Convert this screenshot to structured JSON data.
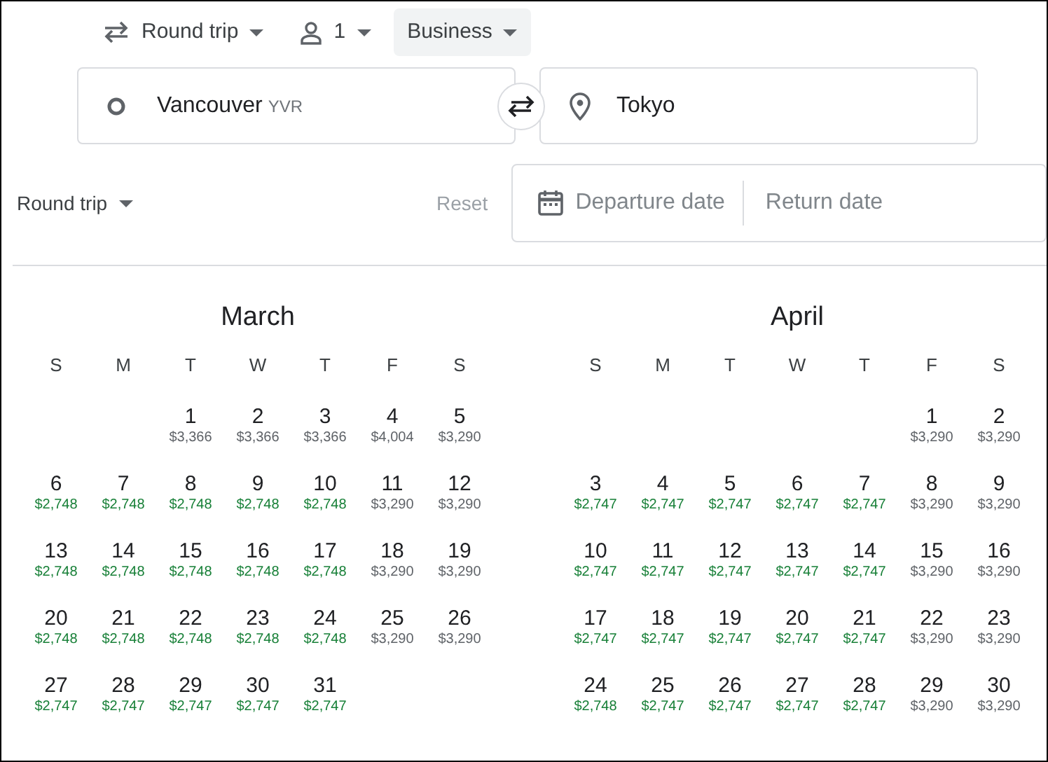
{
  "top_bar": {
    "trip_type": "Round trip",
    "passengers": "1",
    "cabin_class": "Business"
  },
  "route": {
    "origin": {
      "city": "Vancouver",
      "code": "YVR"
    },
    "destination": {
      "city": "Tokyo"
    }
  },
  "date_bar": {
    "trip_type": "Round trip",
    "reset": {
      "label": "Reset",
      "disabled": true
    },
    "departure_placeholder": "Departure date",
    "return_placeholder": "Return date"
  },
  "months": [
    {
      "name": "March",
      "weekdays": [
        "S",
        "M",
        "T",
        "W",
        "T",
        "F",
        "S"
      ],
      "weeks": [
        [
          {
            "day": "1",
            "price": "$3,366",
            "low": false
          },
          {
            "day": "2",
            "price": "$3,366",
            "low": false
          },
          {
            "day": "3",
            "price": "$3,366",
            "low": false
          },
          {
            "day": "4",
            "price": "$4,004",
            "low": false
          },
          {
            "day": "5",
            "price": "$3,290",
            "low": false
          }
        ],
        [
          {
            "day": "6",
            "price": "$2,748",
            "low": true
          },
          {
            "day": "7",
            "price": "$2,748",
            "low": true
          },
          {
            "day": "8",
            "price": "$2,748",
            "low": true
          },
          {
            "day": "9",
            "price": "$2,748",
            "low": true
          },
          {
            "day": "10",
            "price": "$2,748",
            "low": true
          },
          {
            "day": "11",
            "price": "$3,290",
            "low": false
          },
          {
            "day": "12",
            "price": "$3,290",
            "low": false
          }
        ],
        [
          {
            "day": "13",
            "price": "$2,748",
            "low": true
          },
          {
            "day": "14",
            "price": "$2,748",
            "low": true
          },
          {
            "day": "15",
            "price": "$2,748",
            "low": true
          },
          {
            "day": "16",
            "price": "$2,748",
            "low": true
          },
          {
            "day": "17",
            "price": "$2,748",
            "low": true
          },
          {
            "day": "18",
            "price": "$3,290",
            "low": false
          },
          {
            "day": "19",
            "price": "$3,290",
            "low": false
          }
        ],
        [
          {
            "day": "20",
            "price": "$2,748",
            "low": true
          },
          {
            "day": "21",
            "price": "$2,748",
            "low": true
          },
          {
            "day": "22",
            "price": "$2,748",
            "low": true
          },
          {
            "day": "23",
            "price": "$2,748",
            "low": true
          },
          {
            "day": "24",
            "price": "$2,748",
            "low": true
          },
          {
            "day": "25",
            "price": "$3,290",
            "low": false
          },
          {
            "day": "26",
            "price": "$3,290",
            "low": false
          }
        ],
        [
          {
            "day": "27",
            "price": "$2,747",
            "low": true
          },
          {
            "day": "28",
            "price": "$2,747",
            "low": true
          },
          {
            "day": "29",
            "price": "$2,747",
            "low": true
          },
          {
            "day": "30",
            "price": "$2,747",
            "low": true
          },
          {
            "day": "31",
            "price": "$2,747",
            "low": true
          }
        ]
      ]
    },
    {
      "name": "April",
      "weekdays": [
        "S",
        "M",
        "T",
        "W",
        "T",
        "F",
        "S"
      ],
      "weeks": [
        [
          {
            "day": "1",
            "price": "$3,290",
            "low": false
          },
          {
            "day": "2",
            "price": "$3,290",
            "low": false
          }
        ],
        [
          {
            "day": "3",
            "price": "$2,747",
            "low": true
          },
          {
            "day": "4",
            "price": "$2,747",
            "low": true
          },
          {
            "day": "5",
            "price": "$2,747",
            "low": true
          },
          {
            "day": "6",
            "price": "$2,747",
            "low": true
          },
          {
            "day": "7",
            "price": "$2,747",
            "low": true
          },
          {
            "day": "8",
            "price": "$3,290",
            "low": false
          },
          {
            "day": "9",
            "price": "$3,290",
            "low": false
          }
        ],
        [
          {
            "day": "10",
            "price": "$2,747",
            "low": true
          },
          {
            "day": "11",
            "price": "$2,747",
            "low": true
          },
          {
            "day": "12",
            "price": "$2,747",
            "low": true
          },
          {
            "day": "13",
            "price": "$2,747",
            "low": true
          },
          {
            "day": "14",
            "price": "$2,747",
            "low": true
          },
          {
            "day": "15",
            "price": "$3,290",
            "low": false
          },
          {
            "day": "16",
            "price": "$3,290",
            "low": false
          }
        ],
        [
          {
            "day": "17",
            "price": "$2,747",
            "low": true
          },
          {
            "day": "18",
            "price": "$2,747",
            "low": true
          },
          {
            "day": "19",
            "price": "$2,747",
            "low": true
          },
          {
            "day": "20",
            "price": "$2,747",
            "low": true
          },
          {
            "day": "21",
            "price": "$2,747",
            "low": true
          },
          {
            "day": "22",
            "price": "$3,290",
            "low": false
          },
          {
            "day": "23",
            "price": "$3,290",
            "low": false
          }
        ],
        [
          {
            "day": "24",
            "price": "$2,748",
            "low": true
          },
          {
            "day": "25",
            "price": "$2,747",
            "low": true
          },
          {
            "day": "26",
            "price": "$2,747",
            "low": true
          },
          {
            "day": "27",
            "price": "$2,747",
            "low": true
          },
          {
            "day": "28",
            "price": "$2,747",
            "low": true
          },
          {
            "day": "29",
            "price": "$3,290",
            "low": false
          },
          {
            "day": "30",
            "price": "$3,290",
            "low": false
          }
        ]
      ]
    }
  ]
}
